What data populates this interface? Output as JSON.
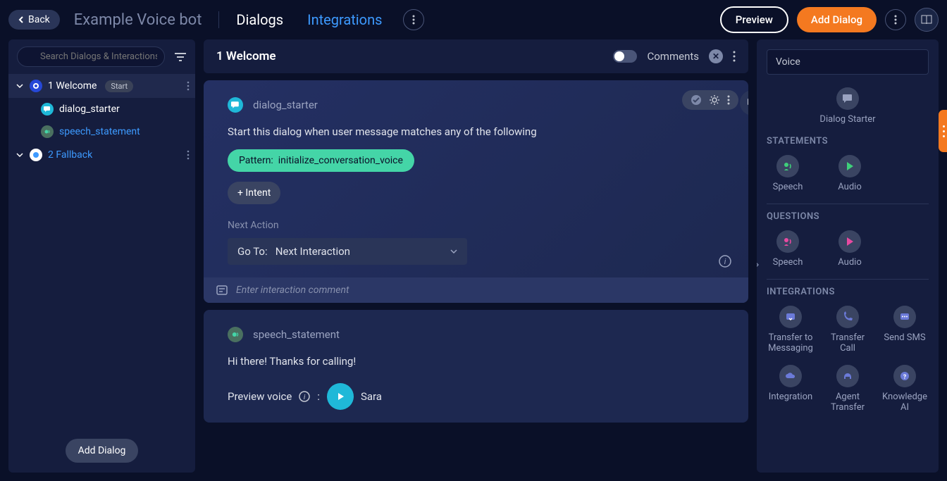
{
  "header": {
    "back": "Back",
    "title": "Example Voice bot",
    "tabs": {
      "dialogs": "Dialogs",
      "integrations": "Integrations"
    },
    "preview": "Preview",
    "add_dialog": "Add Dialog"
  },
  "sidebar": {
    "search_placeholder": "Search Dialogs & Interactions",
    "dialogs": [
      {
        "name": "1 Welcome",
        "start_label": "Start",
        "items": [
          {
            "name": "dialog_starter"
          },
          {
            "name": "speech_statement"
          }
        ]
      },
      {
        "name": "2 Fallback"
      }
    ],
    "add_dialog": "Add Dialog"
  },
  "main": {
    "title": "1 Welcome",
    "comments_label": "Comments",
    "cards": {
      "dialog_starter": {
        "title": "dialog_starter",
        "desc": "Start this dialog when user message matches any of the following",
        "pattern_label": "Pattern:",
        "pattern_value": "initialize_conversation_voice",
        "intent_btn": "+ Intent",
        "next_action_label": "Next Action",
        "select_prefix": "Go To:",
        "select_value": "Next Interaction",
        "comment_placeholder": "Enter interaction comment"
      },
      "speech": {
        "title": "speech_statement",
        "text": "Hi there! Thanks for calling!",
        "preview_label": "Preview voice",
        "colon": ":",
        "voice_name": "Sara"
      }
    }
  },
  "palette": {
    "search_value": "Voice",
    "dialog_starter": "Dialog Starter",
    "sections": {
      "statements": {
        "title": "STATEMENTS",
        "items": [
          "Speech",
          "Audio"
        ]
      },
      "questions": {
        "title": "QUESTIONS",
        "items": [
          "Speech",
          "Audio"
        ]
      },
      "integrations": {
        "title": "INTEGRATIONS",
        "items": [
          "Transfer to Messaging",
          "Transfer Call",
          "Send SMS",
          "Integration",
          "Agent Transfer",
          "Knowledge AI"
        ]
      }
    }
  }
}
